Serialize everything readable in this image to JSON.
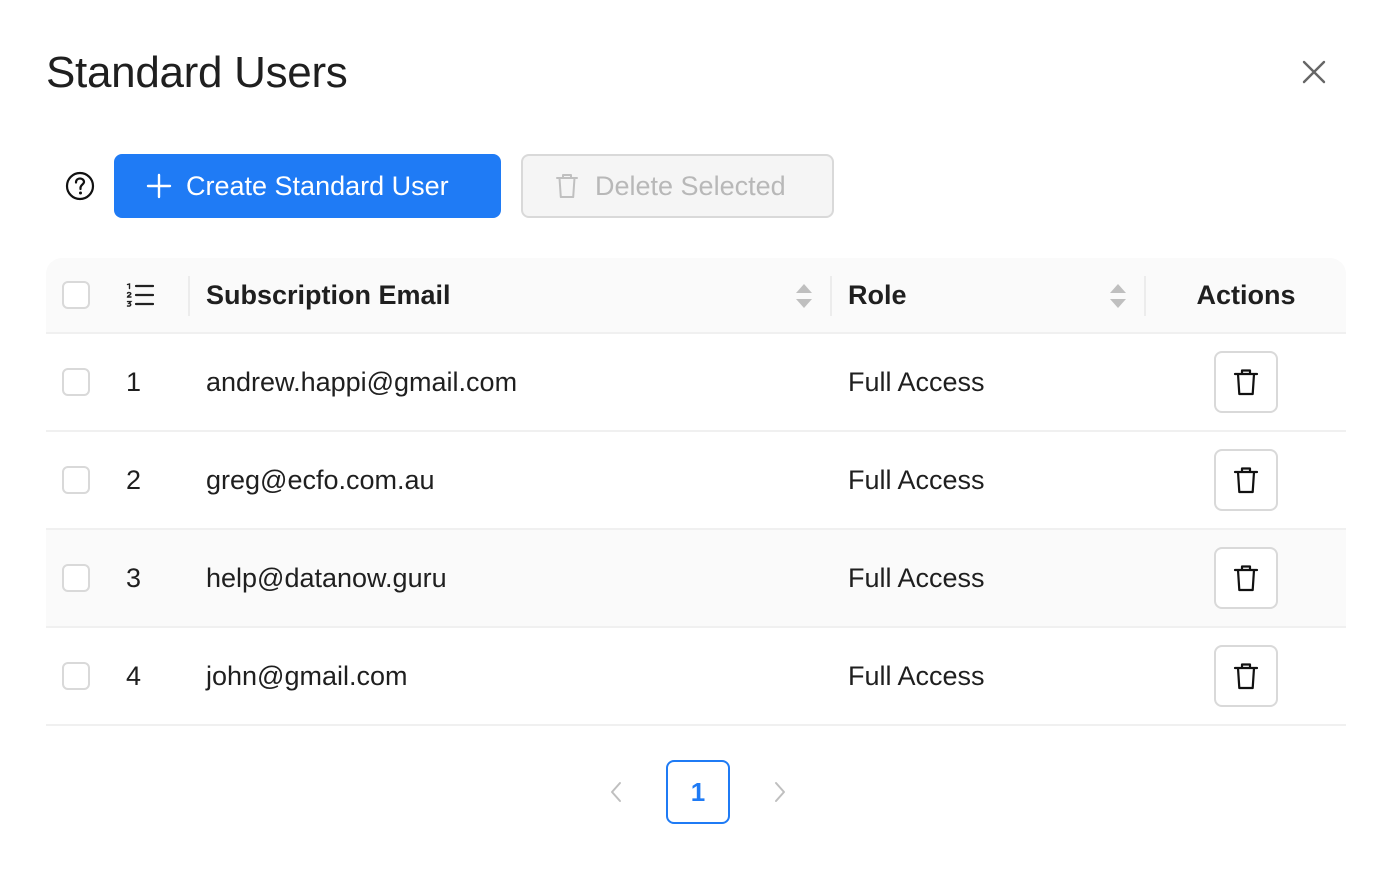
{
  "dialog": {
    "title": "Standard Users"
  },
  "toolbar": {
    "create_label": "Create Standard User",
    "delete_selected_label": "Delete Selected"
  },
  "table": {
    "columns": {
      "email": "Subscription Email",
      "role": "Role",
      "actions": "Actions"
    },
    "rows": [
      {
        "index": "1",
        "email": "andrew.happi@gmail.com",
        "role": "Full Access"
      },
      {
        "index": "2",
        "email": "greg@ecfo.com.au",
        "role": "Full Access"
      },
      {
        "index": "3",
        "email": "help@datanow.guru",
        "role": "Full Access"
      },
      {
        "index": "4",
        "email": "john@gmail.com",
        "role": "Full Access"
      }
    ]
  },
  "pagination": {
    "current_page": "1"
  },
  "colors": {
    "primary": "#1f7bf5",
    "text": "#1f1f1f",
    "disabled_text": "#b8b8b8",
    "border": "#d9d9d9"
  }
}
